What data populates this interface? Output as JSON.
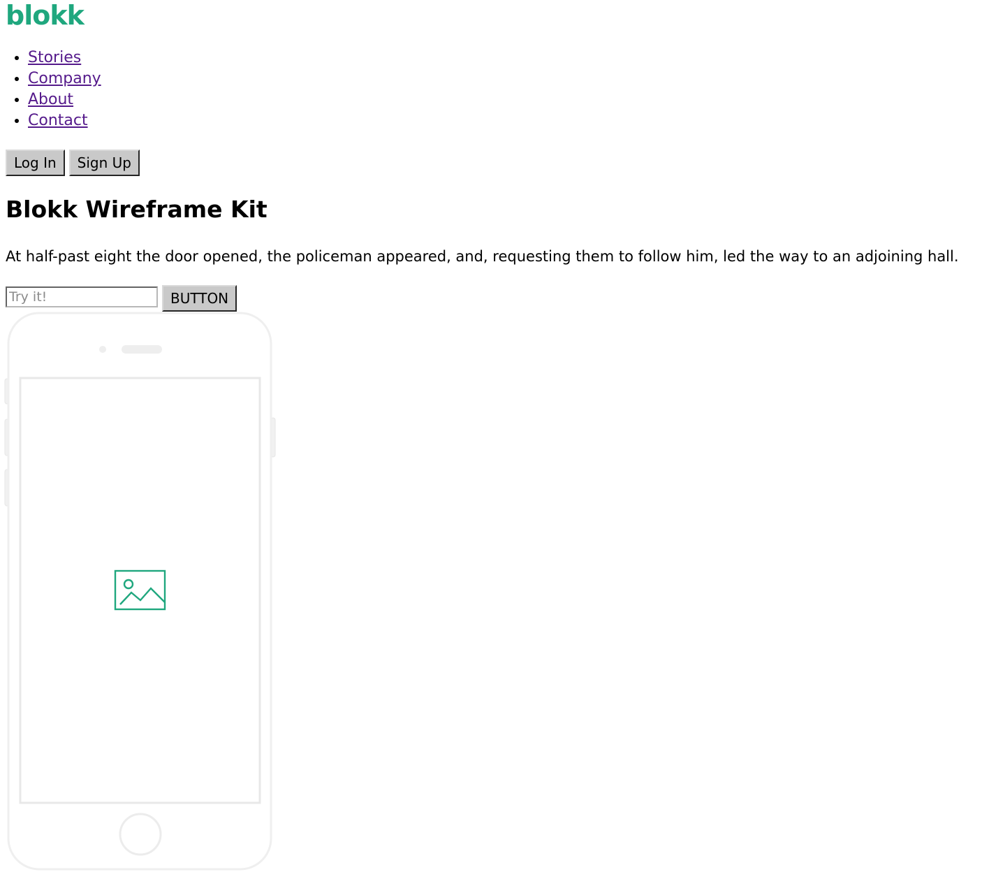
{
  "brand": {
    "logo_text": "blokk",
    "accent_color": "#1fa77e"
  },
  "nav": {
    "items": [
      {
        "label": "Stories"
      },
      {
        "label": "Company"
      },
      {
        "label": "About"
      },
      {
        "label": "Contact"
      }
    ]
  },
  "auth": {
    "login_label": "Log In",
    "signup_label": "Sign Up"
  },
  "hero": {
    "title": "Blokk Wireframe Kit",
    "description": "At half-past eight the door opened, the policeman appeared, and, requesting them to follow him, led the way to an adjoining hall."
  },
  "cta": {
    "input_placeholder": "Try it!",
    "button_label": "BUTTON"
  },
  "device": {
    "icon": "image-placeholder-icon",
    "frame": "phone-outline"
  }
}
